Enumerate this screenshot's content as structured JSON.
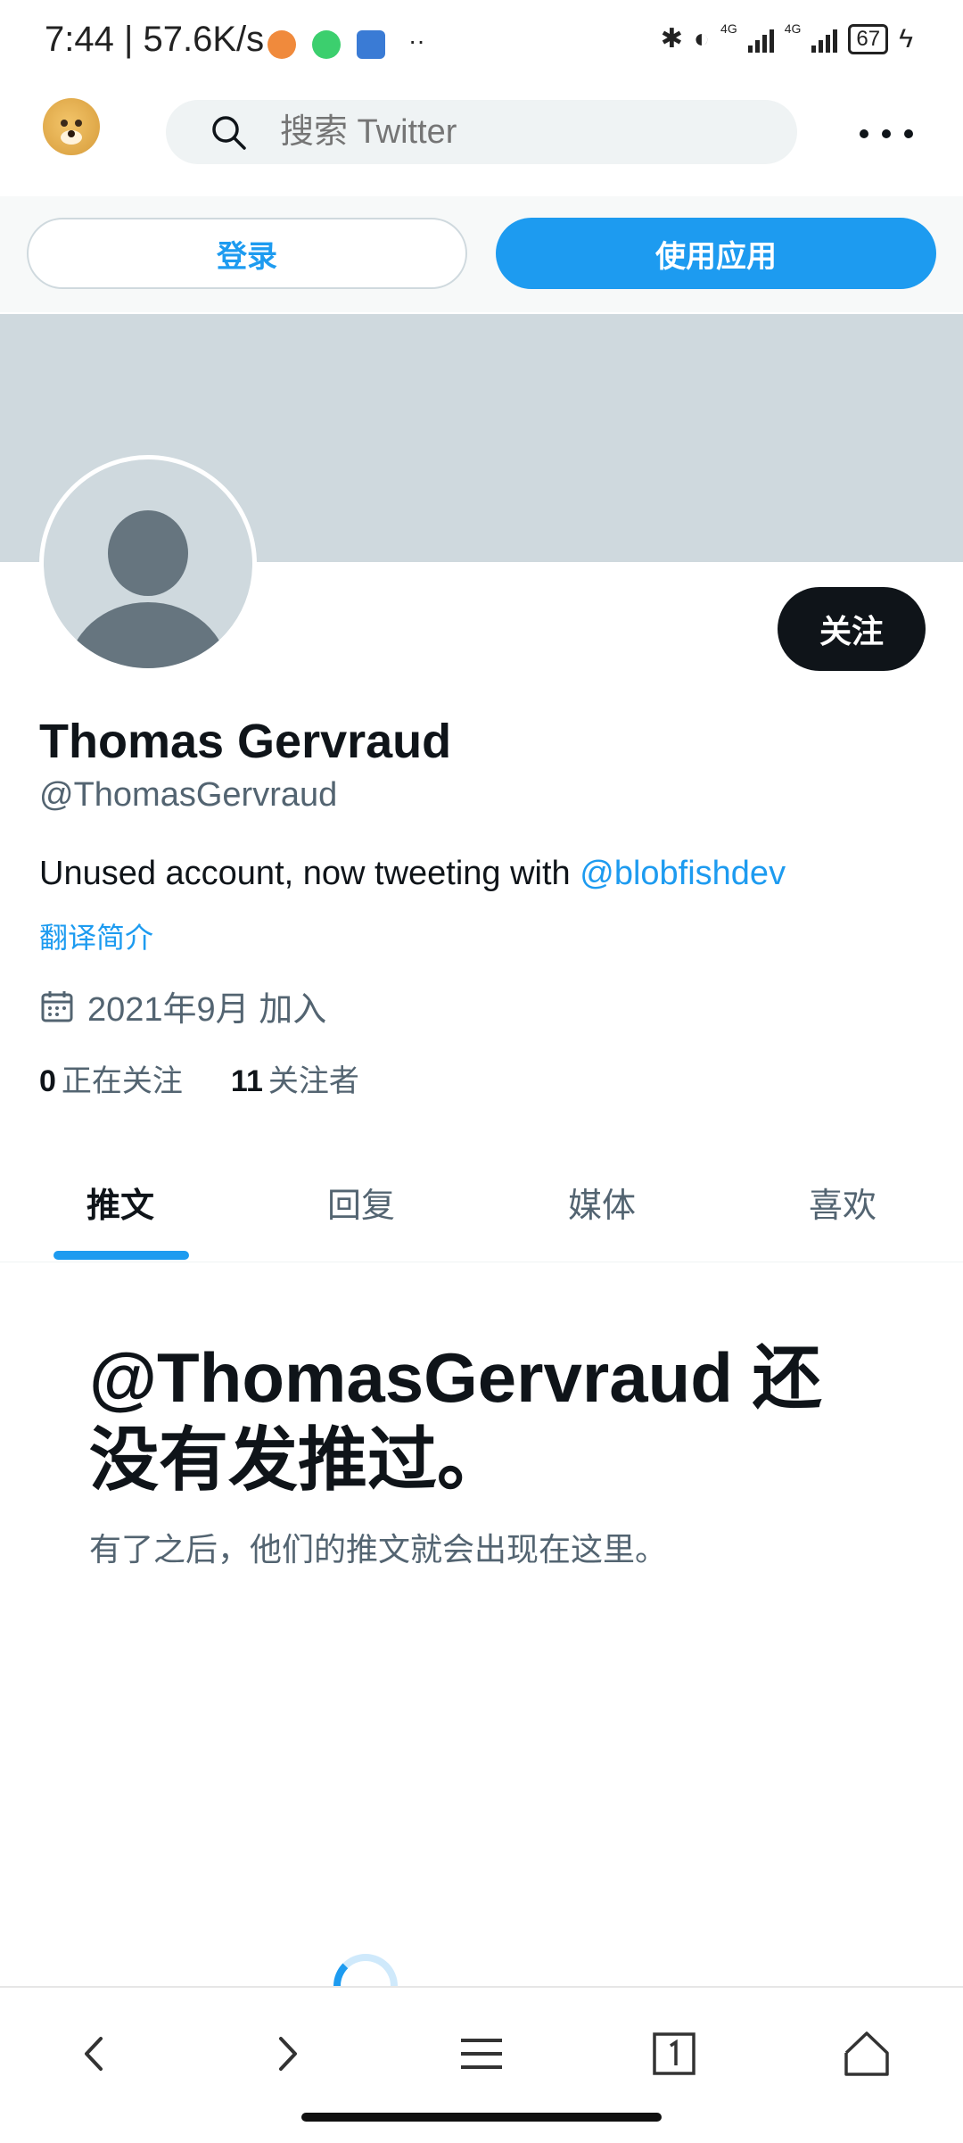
{
  "status_bar": {
    "time": "7:44",
    "speed": "57.6K/s",
    "network_1": "4G",
    "network_2": "4G",
    "battery": "67"
  },
  "top_nav": {
    "search_placeholder": "搜索 Twitter"
  },
  "auth": {
    "login_label": "登录",
    "use_app_label": "使用应用"
  },
  "profile": {
    "follow_label": "关注",
    "display_name": "Thomas Gervraud",
    "handle": "@ThomasGervraud",
    "bio_text": "Unused account, now tweeting with ",
    "bio_mention": "@blobfishdev",
    "translate_label": "翻译简介",
    "joined": "2021年9月 加入",
    "following_count": "0",
    "following_label": "正在关注",
    "followers_count": "11",
    "followers_label": "关注者"
  },
  "tabs": [
    "推文",
    "回复",
    "媒体",
    "喜欢"
  ],
  "empty_state": {
    "title": "@ThomasGervraud 还没有发推过。",
    "subtitle": "有了之后，他们的推文就会出现在这里。"
  },
  "colors": {
    "accent": "#1d9bf0",
    "dark": "#0f1419",
    "muted": "#536471",
    "banner": "#cfd9de"
  }
}
